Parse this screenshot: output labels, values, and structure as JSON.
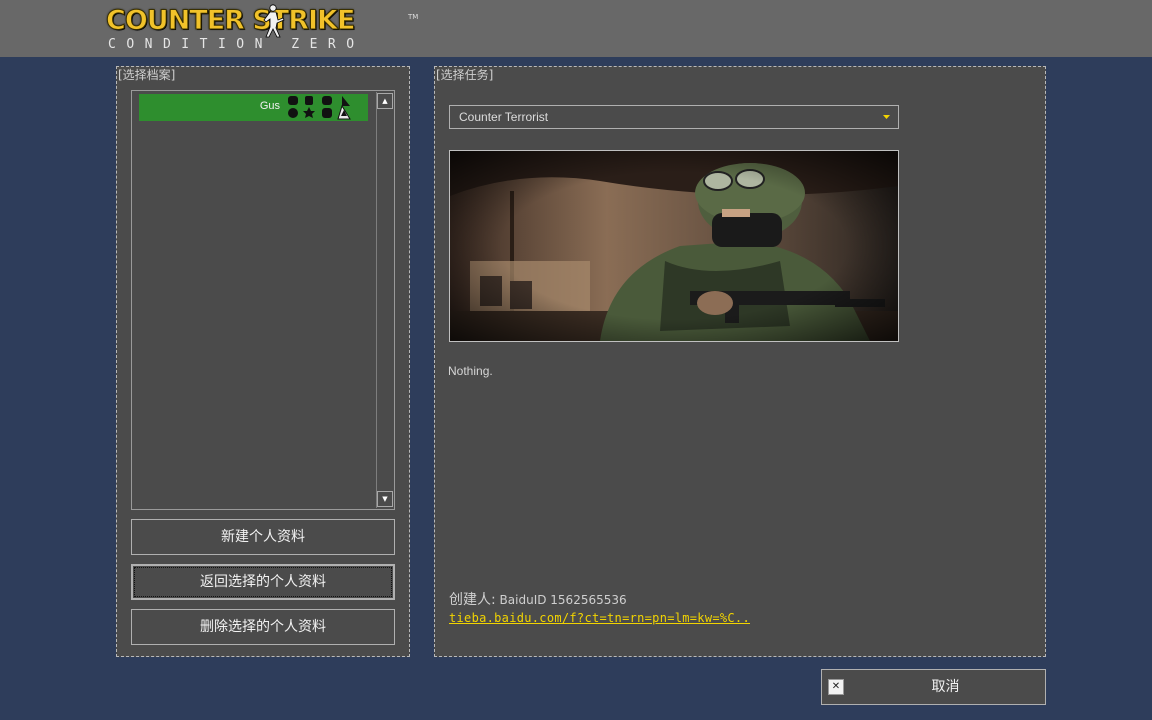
{
  "logo": {
    "line1": "COUNTER STRIKE",
    "line2": "CONDITION ZERO",
    "tm": "TM"
  },
  "profiles_panel": {
    "title": "[选择档案]",
    "items": [
      {
        "name": "Gus",
        "selected": true
      }
    ],
    "buttons": {
      "new": "新建个人资料",
      "back": "返回选择的个人资料",
      "delete": "删除选择的个人资料"
    }
  },
  "mission_panel": {
    "title": "[选择任务]",
    "team_select": {
      "value": "Counter Terrorist"
    },
    "description": "Nothing.",
    "creator_label": "创建人:",
    "creator_value": "BaiduID 1562565536",
    "link": "tieba.baidu.com/f?ct=tn=rn=pn=lm=kw=%C.."
  },
  "cancel": {
    "label": "取消"
  },
  "colors": {
    "background": "#2e3d5b",
    "panel": "#4b4b4b",
    "selected_row": "#2e8e2e",
    "link": "#f2d400",
    "logo": "#f1c22a"
  }
}
